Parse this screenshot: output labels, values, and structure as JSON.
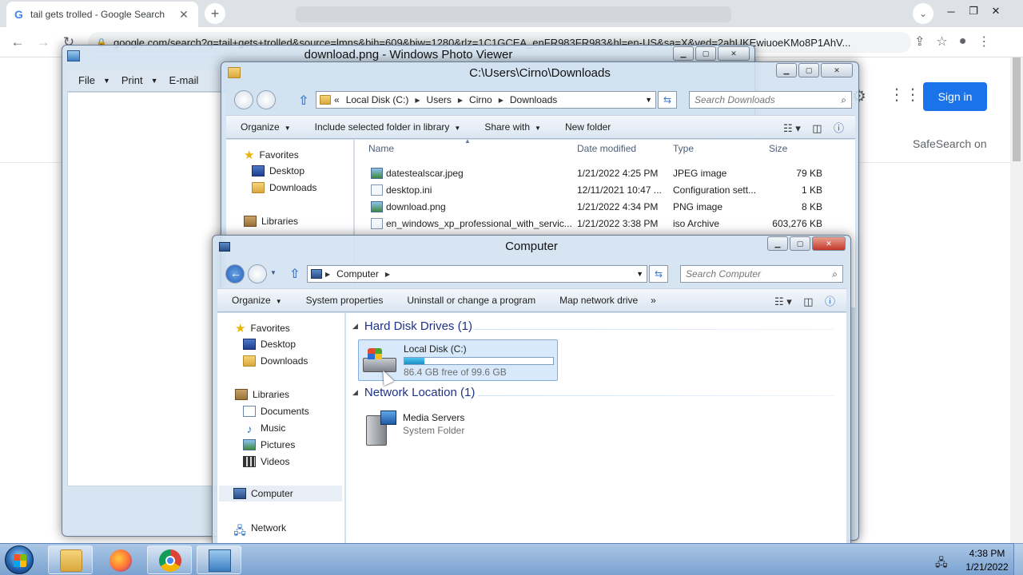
{
  "chrome": {
    "tab_title": "tail gets trolled - Google Search",
    "tab_icon": "G",
    "address_url": "google.com/search?q=tail+gets+trolled&source=lmns&bih=609&biw=1280&rlz=1C1GCEA_enFR983FR983&hl=en-US&sa=X&ved=2ahUKEwiuoeKMo8P1AhV..."
  },
  "google": {
    "sign_in": "Sign in",
    "safesearch": "SafeSearch on",
    "sign_in_color": "#1a73e8"
  },
  "photo_viewer": {
    "title": "download.png - Windows Photo Viewer",
    "menu": [
      "File",
      "Print",
      "E-mail"
    ]
  },
  "downloads": {
    "title": "C:\\Users\\Cirno\\Downloads",
    "path_prefix": "«",
    "path": [
      "Local Disk (C:)",
      "Users",
      "Cirno",
      "Downloads"
    ],
    "search_placeholder": "Search Downloads",
    "commands": [
      "Organize",
      "Include selected folder in library",
      "Share with",
      "New folder"
    ],
    "nav": {
      "favorites": "Favorites",
      "desktop": "Desktop",
      "downloads": "Downloads",
      "libraries": "Libraries"
    },
    "columns": {
      "name": "Name",
      "date": "Date modified",
      "type": "Type",
      "size": "Size"
    },
    "files": [
      {
        "name": "datestealscar.jpeg",
        "date": "1/21/2022 4:25 PM",
        "type": "JPEG image",
        "size": "79 KB"
      },
      {
        "name": "desktop.ini",
        "date": "12/11/2021 10:47 ...",
        "type": "Configuration sett...",
        "size": "1 KB"
      },
      {
        "name": "download.png",
        "date": "1/21/2022 4:34 PM",
        "type": "PNG image",
        "size": "8 KB"
      },
      {
        "name": "en_windows_xp_professional_with_servic...",
        "date": "1/21/2022 3:38 PM",
        "type": "iso Archive",
        "size": "603,276 KB"
      }
    ]
  },
  "computer": {
    "title": "Computer",
    "path": [
      "Computer"
    ],
    "search_placeholder": "Search Computer",
    "commands": [
      "Organize",
      "System properties",
      "Uninstall or change a program",
      "Map network drive",
      "»"
    ],
    "nav": {
      "favorites": "Favorites",
      "desktop": "Desktop",
      "downloads": "Downloads",
      "libraries": "Libraries",
      "documents": "Documents",
      "music": "Music",
      "pictures": "Pictures",
      "videos": "Videos",
      "computer": "Computer",
      "network": "Network"
    },
    "groups": {
      "hdd": "Hard Disk Drives (1)",
      "network": "Network Location (1)"
    },
    "drive": {
      "name": "Local Disk (C:)",
      "free": "86.4 GB free of 99.6 GB",
      "used_fraction": 0.133
    },
    "media": {
      "name": "Media Servers",
      "type": "System Folder"
    }
  },
  "taskbar": {
    "time": "4:38 PM",
    "date": "1/21/2022"
  }
}
